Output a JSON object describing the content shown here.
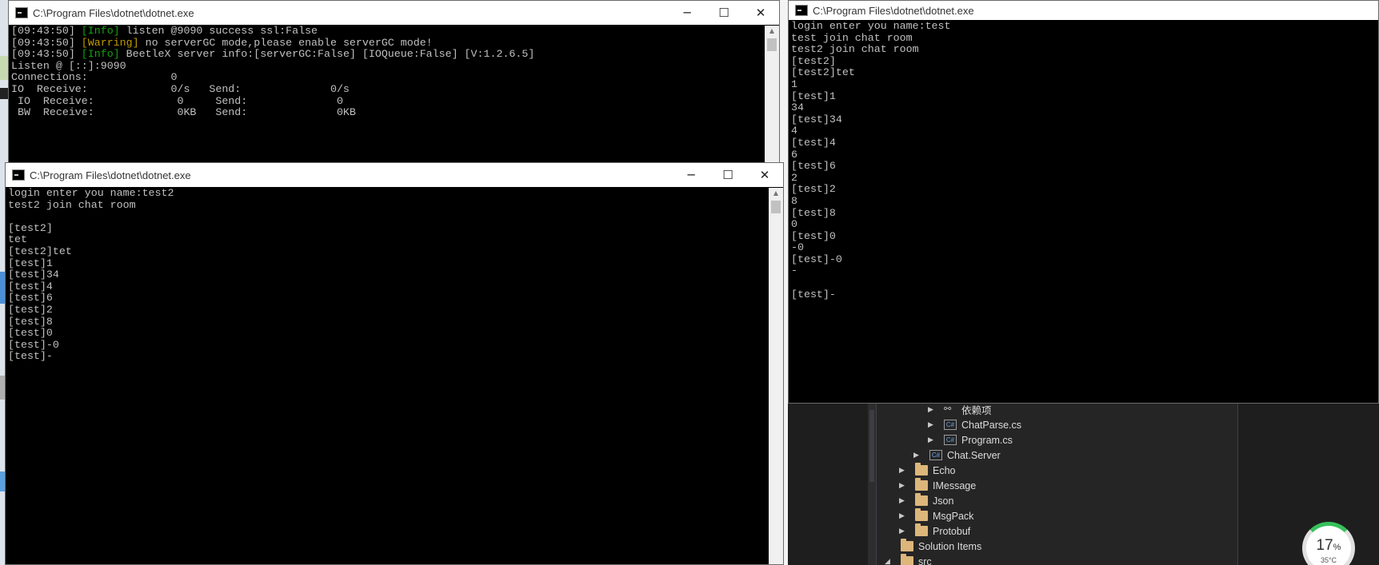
{
  "server_window": {
    "title": "C:\\Program Files\\dotnet\\dotnet.exe",
    "lines": [
      {
        "time": "[09:43:50] ",
        "tag": "[Info]",
        "tag_type": "info",
        "text": " listen @9090 success ssl:False"
      },
      {
        "time": "[09:43:50] ",
        "tag": "[Warring]",
        "tag_type": "warn",
        "text": " no serverGC mode,please enable serverGC mode!"
      },
      {
        "time": "[09:43:50] ",
        "tag": "[Info]",
        "tag_type": "info",
        "text": " BeetleX server info:[serverGC:False] [IOQueue:False] [V:1.2.6.5]"
      },
      {
        "time": "",
        "tag": "",
        "tag_type": "",
        "text": "Listen @ [::]:9090"
      },
      {
        "time": "",
        "tag": "",
        "tag_type": "",
        "text": "Connections:             0"
      },
      {
        "time": "",
        "tag": "",
        "tag_type": "",
        "text": "IO  Receive:             0/s   Send:              0/s"
      },
      {
        "time": "",
        "tag": "",
        "tag_type": "",
        "text": " IO  Receive:             0     Send:              0"
      },
      {
        "time": "",
        "tag": "",
        "tag_type": "",
        "text": " BW  Receive:             0KB   Send:              0KB"
      }
    ]
  },
  "client2_window": {
    "title": "C:\\Program Files\\dotnet\\dotnet.exe",
    "lines": [
      "login enter you name:test2",
      "test2 join chat room",
      "",
      "[test2]",
      "tet",
      "[test2]tet",
      "[test]1",
      "[test]34",
      "[test]4",
      "[test]6",
      "[test]2",
      "[test]8",
      "[test]0",
      "[test]-0",
      "[test]-"
    ]
  },
  "client1_window": {
    "title": "C:\\Program Files\\dotnet\\dotnet.exe",
    "lines": [
      "login enter you name:test",
      "test join chat room",
      "test2 join chat room",
      "[test2]",
      "[test2]tet",
      "1",
      "[test]1",
      "34",
      "[test]34",
      "4",
      "[test]4",
      "6",
      "[test]6",
      "2",
      "[test]2",
      "8",
      "[test]8",
      "0",
      "[test]0",
      "-0",
      "[test]-0",
      "-",
      "",
      "[test]-"
    ]
  },
  "solution_explorer": {
    "items": [
      {
        "label": "依赖项",
        "icon": "dependencies-icon",
        "depth": 3
      },
      {
        "label": "ChatParse.cs",
        "icon": "csharp-file-icon",
        "depth": 3
      },
      {
        "label": "Program.cs",
        "icon": "csharp-file-icon",
        "depth": 3
      },
      {
        "label": "Chat.Server",
        "icon": "csharp-project-icon",
        "depth": 2
      },
      {
        "label": "Echo",
        "icon": "folder-icon",
        "depth": 1
      },
      {
        "label": "IMessage",
        "icon": "folder-icon",
        "depth": 1
      },
      {
        "label": "Json",
        "icon": "folder-icon",
        "depth": 1
      },
      {
        "label": "MsgPack",
        "icon": "folder-icon",
        "depth": 1
      },
      {
        "label": "Protobuf",
        "icon": "folder-icon",
        "depth": 1
      },
      {
        "label": "Solution Items",
        "icon": "folder-icon",
        "depth": 0
      },
      {
        "label": "src",
        "icon": "folder-icon",
        "depth": 0
      }
    ]
  },
  "system_monitor": {
    "percent": "17",
    "percent_unit": "%",
    "temperature": "35°C"
  },
  "colors": {
    "console_bg": "#000000",
    "console_fg": "#c0c0c0",
    "info_tag": "#13a10e",
    "warn_tag": "#c19c00",
    "vs_bg": "#252526"
  }
}
